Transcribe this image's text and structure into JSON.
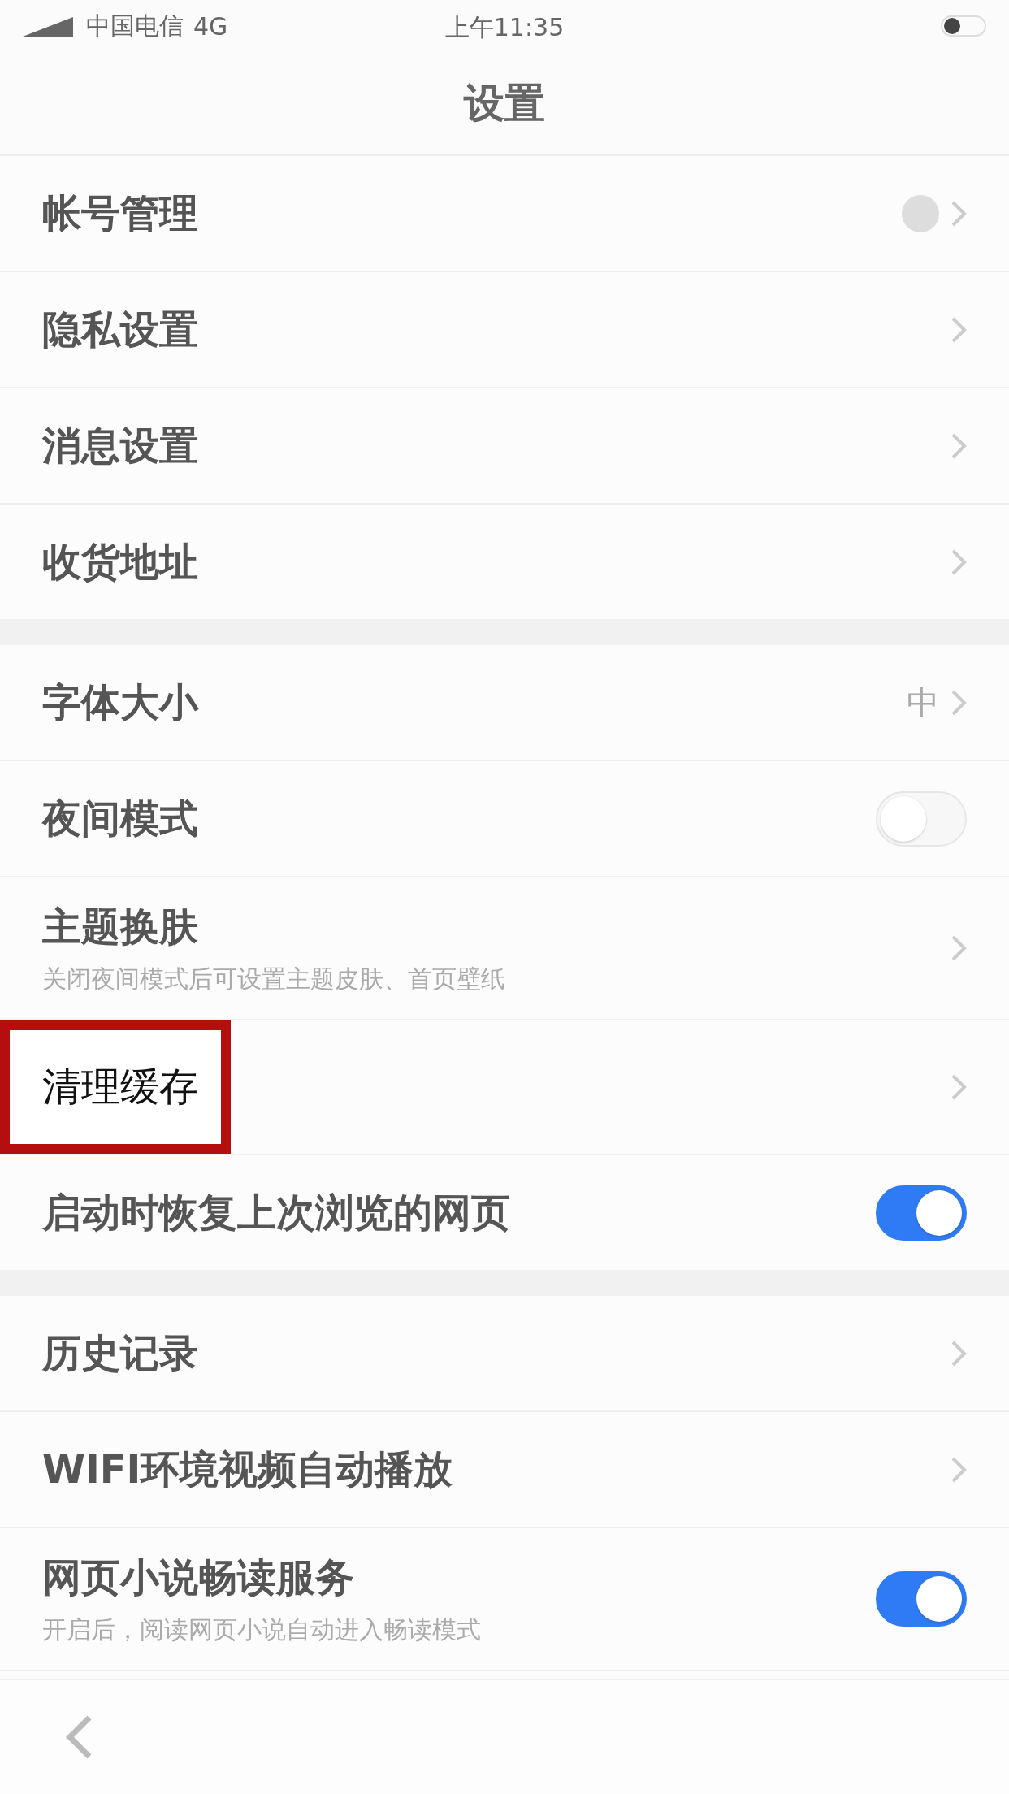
{
  "status_bar": {
    "carrier": "中国电信",
    "network": "4G",
    "time": "上午11:35"
  },
  "title": "设置",
  "sections": [
    {
      "rows": [
        {
          "kind": "link",
          "label": "帐号管理",
          "avatar": true
        },
        {
          "kind": "link",
          "label": "隐私设置"
        },
        {
          "kind": "link",
          "label": "消息设置"
        },
        {
          "kind": "link",
          "label": "收货地址"
        }
      ]
    },
    {
      "rows": [
        {
          "kind": "link",
          "label": "字体大小",
          "value": "中"
        },
        {
          "kind": "toggle",
          "label": "夜间模式",
          "on": false
        },
        {
          "kind": "link",
          "label": "主题换肤",
          "subtitle": "关闭夜间模式后可设置主题皮肤、首页壁纸"
        },
        {
          "kind": "link",
          "label": "清理缓存",
          "highlighted": true
        },
        {
          "kind": "toggle",
          "label": "启动时恢复上次浏览的网页",
          "on": true
        }
      ]
    },
    {
      "rows": [
        {
          "kind": "link",
          "label": "历史记录"
        },
        {
          "kind": "link",
          "label": "WIFI环境视频自动播放"
        },
        {
          "kind": "toggle",
          "label": "网页小说畅读服务",
          "subtitle": "开启后，阅读网页小说自动进入畅读模式",
          "on": true
        }
      ]
    }
  ]
}
